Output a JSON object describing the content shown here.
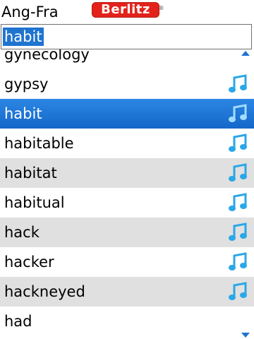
{
  "header": {
    "title": "Ang-Fra",
    "logo_text": "Berlitz",
    "logo_mark": "®"
  },
  "search": {
    "value": "habit"
  },
  "list": {
    "items": [
      {
        "word": "gynecology",
        "audio": false,
        "selected": false
      },
      {
        "word": "gypsy",
        "audio": true,
        "selected": false
      },
      {
        "word": "habit",
        "audio": true,
        "selected": true
      },
      {
        "word": "habitable",
        "audio": true,
        "selected": false
      },
      {
        "word": "habitat",
        "audio": true,
        "selected": false
      },
      {
        "word": "habitual",
        "audio": true,
        "selected": false
      },
      {
        "word": "hack",
        "audio": true,
        "selected": false
      },
      {
        "word": "hacker",
        "audio": true,
        "selected": false
      },
      {
        "word": "hackneyed",
        "audio": true,
        "selected": false
      },
      {
        "word": "had",
        "audio": false,
        "selected": false
      }
    ]
  },
  "icons": {
    "audio": "music-note-icon",
    "scroll_up": "scroll-up-arrow-icon",
    "scroll_down": "scroll-down-arrow-icon"
  },
  "colors": {
    "selection": "#1f74d0",
    "row_shade": "#e0e0e0",
    "logo_red": "#e2221b",
    "note_blue": "#2aa7e8"
  }
}
